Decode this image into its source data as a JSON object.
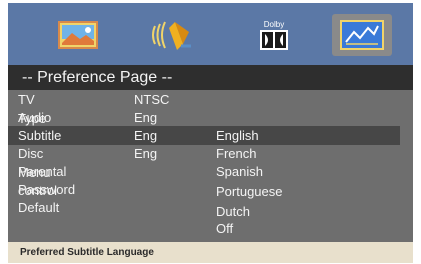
{
  "topbar": {
    "tabs": [
      {
        "icon": "landscape-picture-icon",
        "active": false
      },
      {
        "icon": "speaker-audio-icon",
        "active": false
      },
      {
        "icon": "dolby-icon",
        "label": "Dolby",
        "active": false
      },
      {
        "icon": "preference-chart-icon",
        "active": true
      }
    ]
  },
  "header": {
    "title": "-- Preference Page --"
  },
  "menu": {
    "items": [
      {
        "label": "TV Type",
        "value": "NTSC"
      },
      {
        "label": "Audio",
        "value": "Eng"
      },
      {
        "label": "Subtitle",
        "value": "Eng"
      },
      {
        "label": "Disc Menu",
        "value": "Eng"
      },
      {
        "label": "Parental control",
        "value": ""
      },
      {
        "label": "Password",
        "value": ""
      },
      {
        "label": "Default",
        "value": ""
      }
    ]
  },
  "options": [
    "English",
    "French",
    "Spanish",
    "Portuguese",
    "Dutch",
    "Off"
  ],
  "status": {
    "text": "Preferred Subtitle Language"
  },
  "colors": {
    "topbar": "#5b78a6",
    "header": "#2e2e2e",
    "panel": "#6e6e6e",
    "highlight": "#474747",
    "status": "#e8e0cc"
  }
}
